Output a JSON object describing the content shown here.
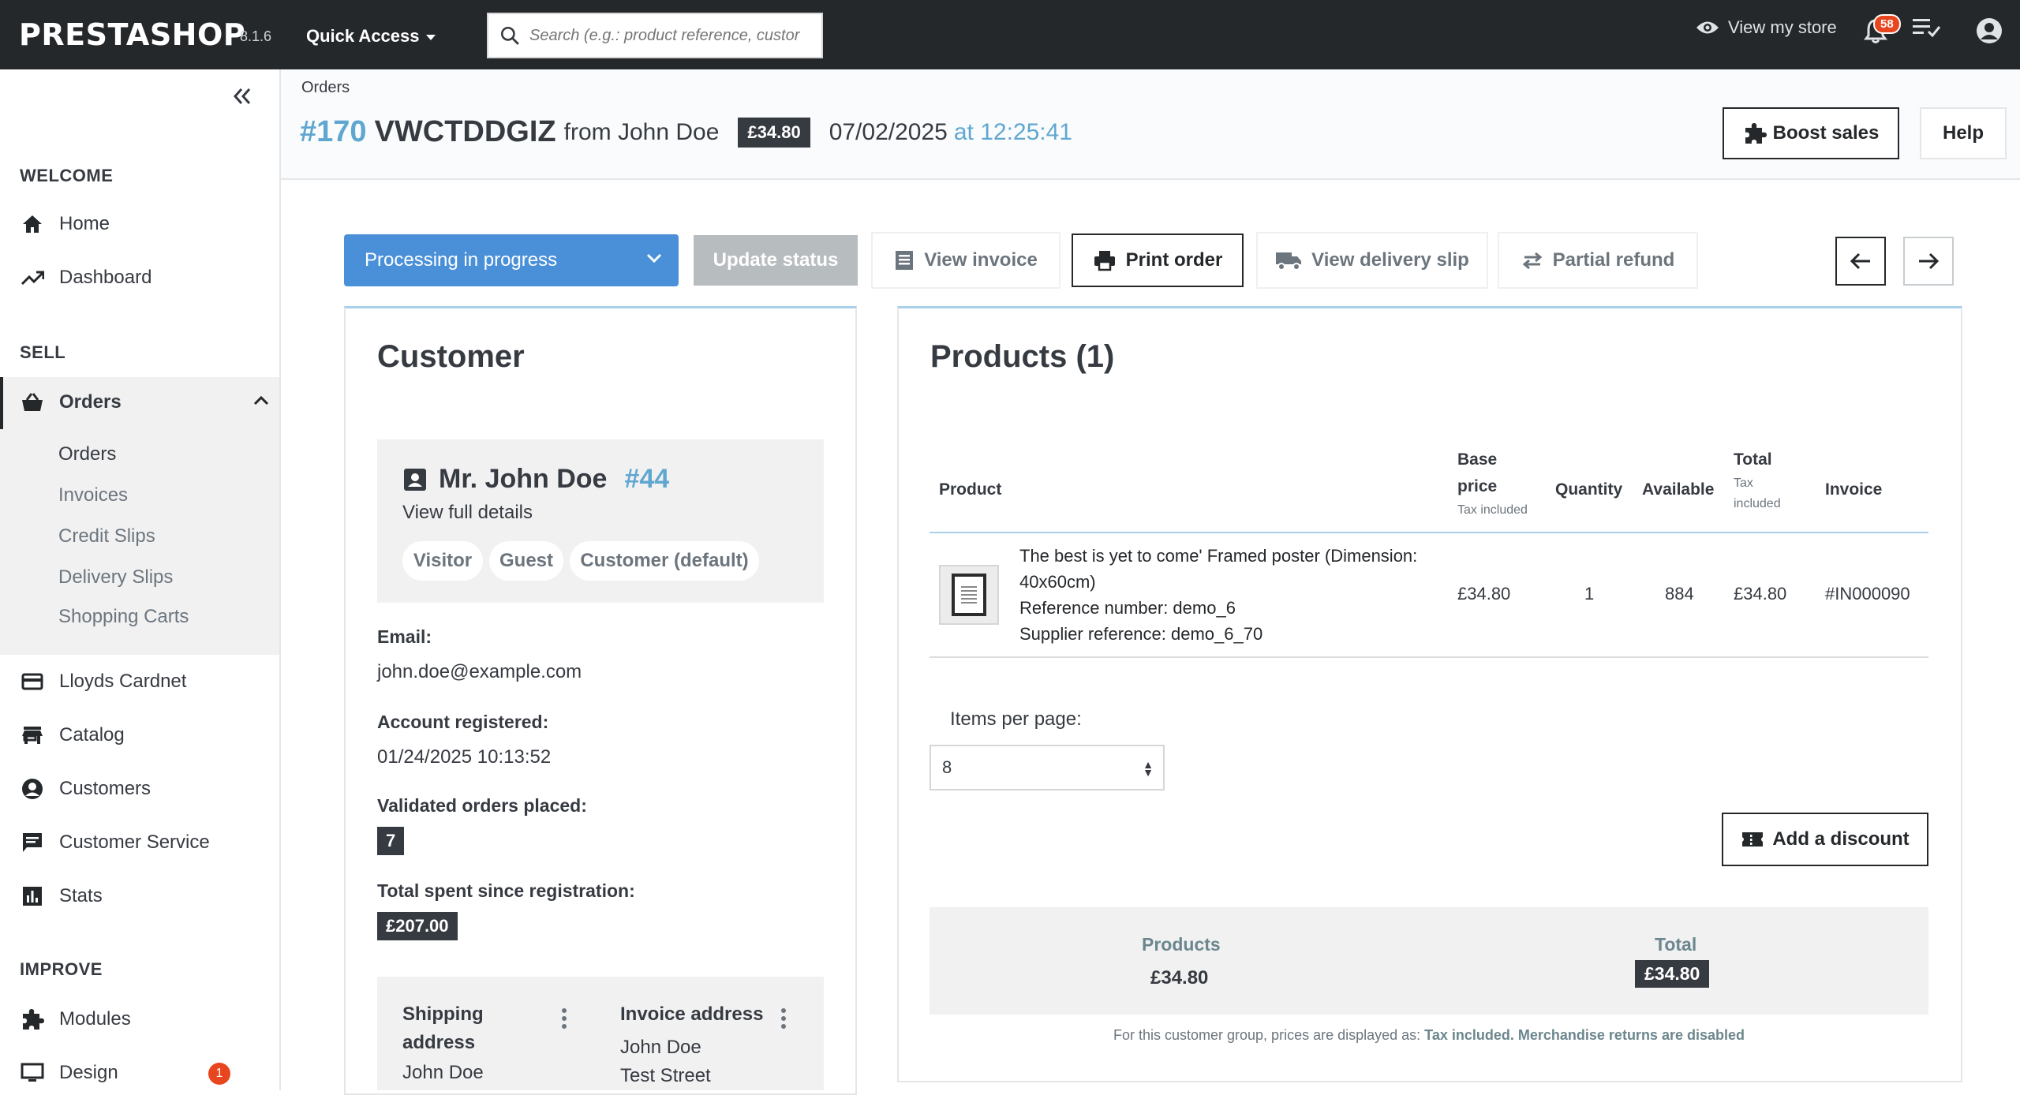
{
  "header": {
    "logo": "PRESTASHOP",
    "version": "8.1.6",
    "quick_access": "Quick Access",
    "search_placeholder": "Search (e.g.: product reference, custor",
    "view_store": "View my store",
    "notifications_count": "58"
  },
  "sidebar": {
    "sections": {
      "welcome": "WELCOME",
      "sell": "SELL",
      "improve": "IMPROVE"
    },
    "items": {
      "home": "Home",
      "dashboard": "Dashboard",
      "orders": "Orders",
      "lloyds": "Lloyds Cardnet",
      "catalog": "Catalog",
      "customers": "Customers",
      "customer_service": "Customer Service",
      "stats": "Stats",
      "modules": "Modules",
      "design": "Design"
    },
    "orders_sub": [
      "Orders",
      "Invoices",
      "Credit Slips",
      "Delivery Slips",
      "Shopping Carts"
    ],
    "design_badge": "1"
  },
  "page": {
    "breadcrumb": "Orders",
    "order_num": "#170",
    "order_ref": "VWCTDDGIZ",
    "from": "from John Doe",
    "price": "£34.80",
    "date": "07/02/2025",
    "time": "at 12:25:41",
    "boost_sales": "Boost sales",
    "help": "Help"
  },
  "actions": {
    "status": "Processing in progress",
    "update_status": "Update status",
    "view_invoice": "View invoice",
    "print_order": "Print order",
    "view_delivery_slip": "View delivery slip",
    "partial_refund": "Partial refund"
  },
  "customer": {
    "title": "Customer",
    "name": "Mr. John Doe",
    "id": "#44",
    "view_full": "View full details",
    "groups": [
      "Visitor",
      "Guest",
      "Customer (default)"
    ],
    "email_label": "Email:",
    "email": "john.doe@example.com",
    "registered_label": "Account registered:",
    "registered": "01/24/2025 10:13:52",
    "validated_label": "Validated orders placed:",
    "validated": "7",
    "spent_label": "Total spent since registration:",
    "spent": "£207.00",
    "shipping_label_1": "Shipping",
    "shipping_label_2": "address",
    "shipping_name": "John Doe",
    "invoice_label": "Invoice address",
    "invoice_name": "John Doe",
    "invoice_street": "Test Street"
  },
  "products": {
    "title": "Products (1)",
    "headers": {
      "product": "Product",
      "base_1": "Base",
      "base_2": "price",
      "base_sub": "Tax included",
      "quantity": "Quantity",
      "available": "Available",
      "total": "Total",
      "total_sub_1": "Tax",
      "total_sub_2": "included",
      "invoice": "Invoice"
    },
    "row": {
      "name_1": "The best is yet to come' Framed poster (Dimension:",
      "name_2": "40x60cm)",
      "reference": "Reference number: demo_6",
      "supplier": "Supplier reference: demo_6_70",
      "base_price": "£34.80",
      "quantity": "1",
      "available": "884",
      "total": "£34.80",
      "invoice": "#IN000090"
    },
    "items_per_page_label": "Items per page:",
    "items_per_page": "8",
    "add_discount": "Add a discount",
    "totals": {
      "products_label": "Products",
      "products_value": "£34.80",
      "total_label": "Total",
      "total_value": "£34.80"
    },
    "note_prefix": "For this customer group, prices are displayed as:",
    "note_tax": "Tax included",
    "note_returns": "Merchandise returns are disabled"
  },
  "colors": {
    "header_bg": "#25282b",
    "accent_blue": "#5fa7d0",
    "status_blue": "#4a90d9",
    "badge_red": "#e8461f"
  }
}
